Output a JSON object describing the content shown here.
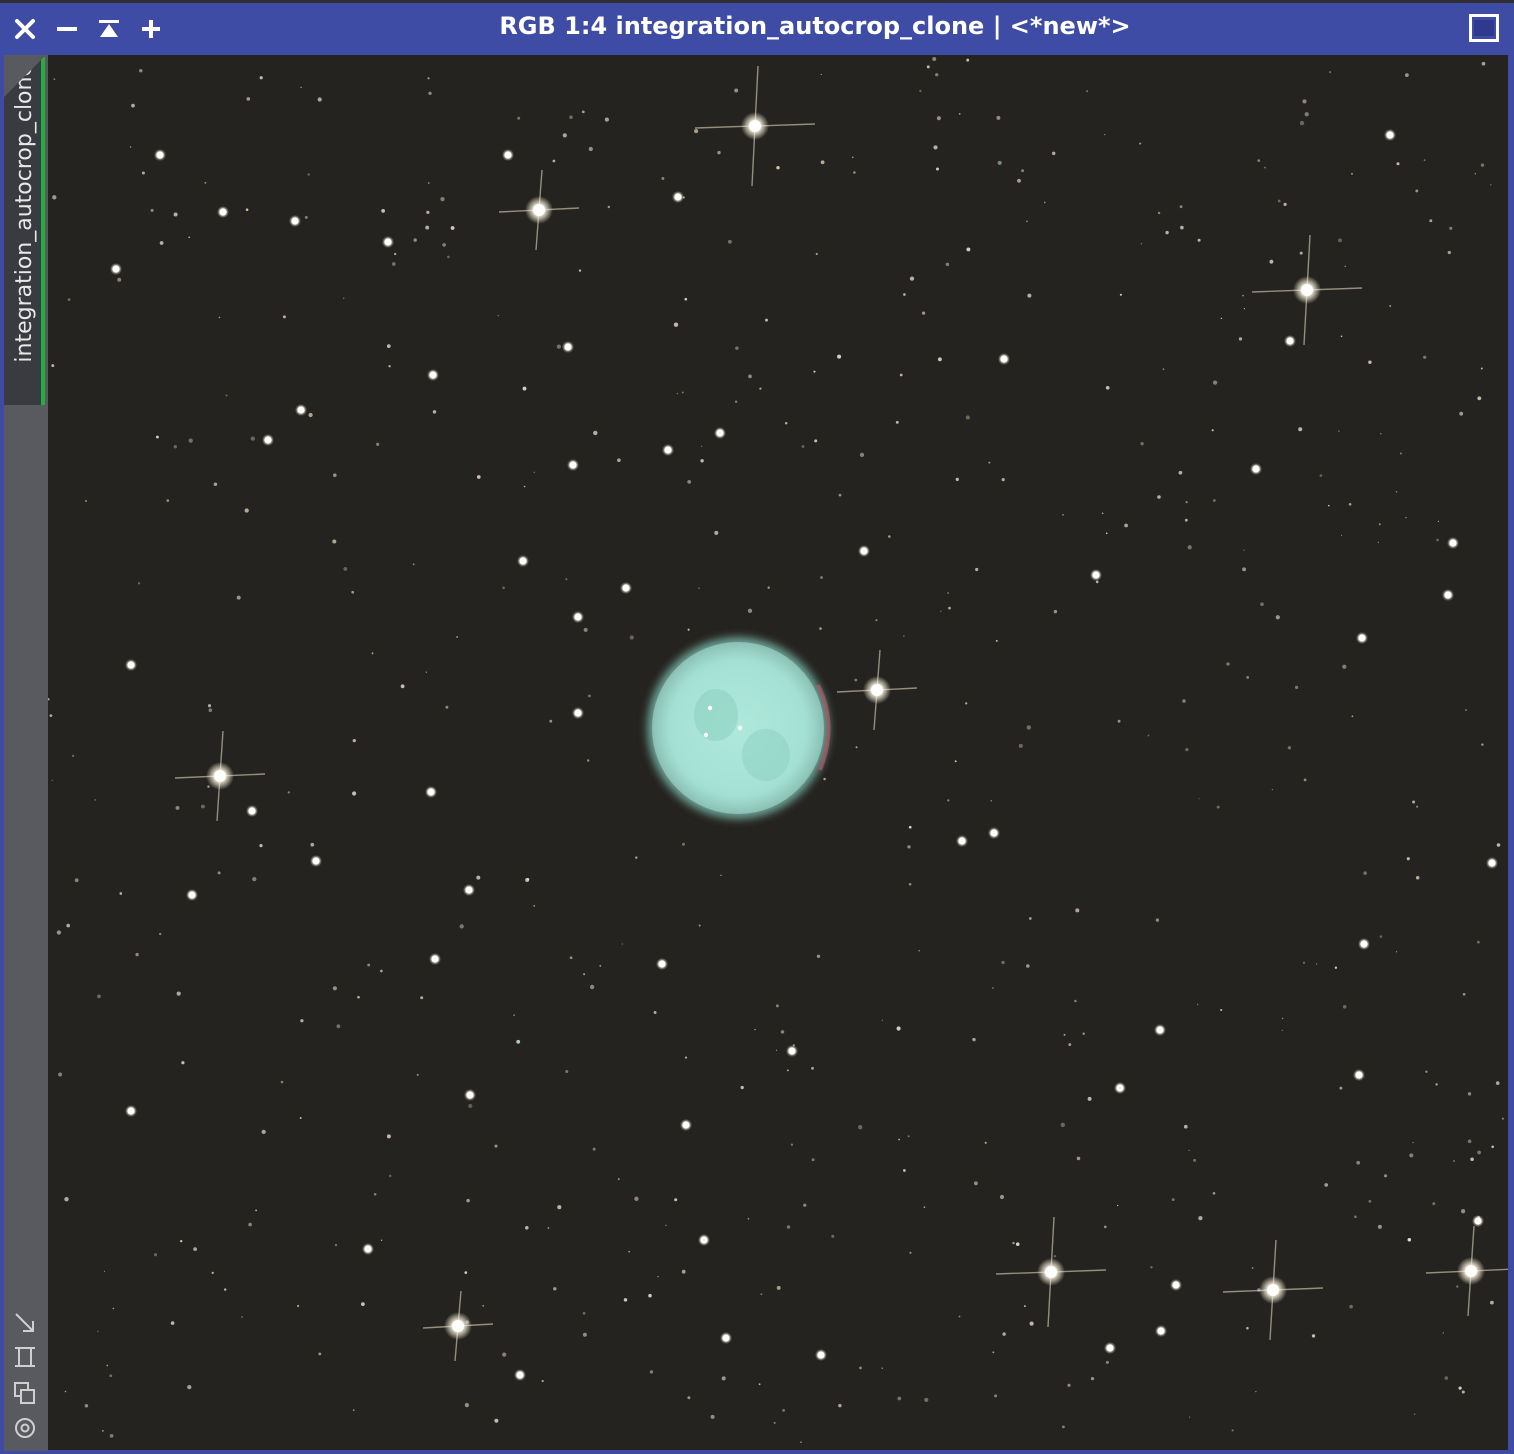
{
  "window": {
    "title": "RGB 1:4 integration_autocrop_clone | <*new*>",
    "close_icon": "close-icon",
    "shade_icon": "minimize-icon",
    "roll_icon": "shade-icon",
    "add_icon": "plus-icon",
    "maximize_icon": "maximize-icon"
  },
  "view_tab": {
    "label": "integration_autocrop_clone",
    "accent": "#21b040"
  },
  "side_tools": [
    "fit-view-icon",
    "zoom-to-selection-icon",
    "clone-view-icon",
    "target-icon"
  ],
  "colors": {
    "titlebar": "#3f4ca6",
    "sky": "#25231f",
    "nebula": "#a8e3d6"
  }
}
